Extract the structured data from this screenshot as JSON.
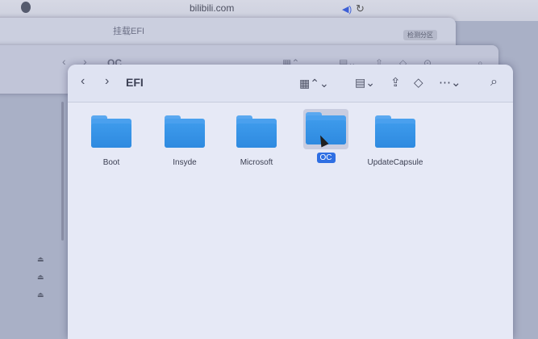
{
  "browser": {
    "url": "bilibili.com"
  },
  "bg_window_3": {
    "title": "挂载EFI",
    "badge": "检测分区"
  },
  "bg_window_2": {
    "title": "OC"
  },
  "finder": {
    "title": "EFI",
    "items": [
      {
        "label": "Boot",
        "selected": false
      },
      {
        "label": "Insyde",
        "selected": false
      },
      {
        "label": "Microsoft",
        "selected": false
      },
      {
        "label": "OC",
        "selected": true
      },
      {
        "label": "UpdateCapsule",
        "selected": false
      }
    ]
  },
  "sidebar": {
    "eject_icons": [
      "eject-icon",
      "eject-icon",
      "eject-icon"
    ]
  },
  "icons": {
    "back": "chevron-left-icon",
    "forward": "chevron-right-icon",
    "view": "grid-view-icon",
    "group": "group-icon",
    "share": "share-icon",
    "tag": "tag-icon",
    "more": "ellipsis-icon",
    "search": "search-icon"
  },
  "colors": {
    "folder": "#3d9aeb",
    "selection": "#2f6fe3"
  }
}
